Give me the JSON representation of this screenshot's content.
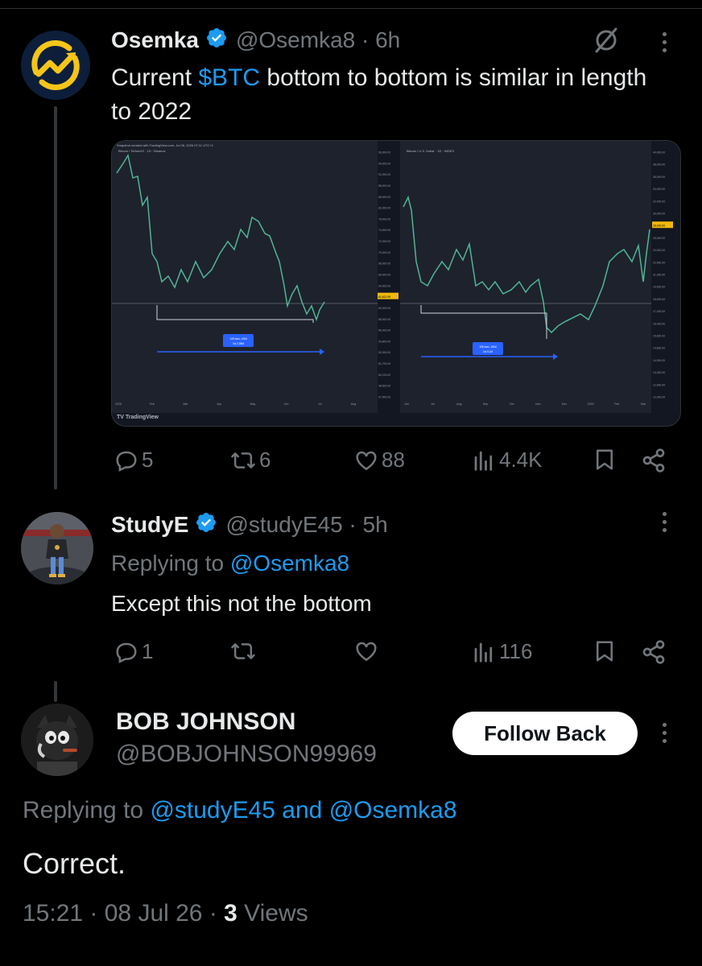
{
  "tweet1": {
    "name": "Osemka",
    "handle_meta": "@Osemka8 · 6h",
    "text_pre": "Current ",
    "cashtag": "$BTC",
    "text_post": " bottom to bottom is similar in length to 2022",
    "stats": {
      "replies": "5",
      "reposts": "6",
      "likes": "88",
      "views": "4.4K"
    },
    "icons": {
      "avatar": "osemka-logo",
      "grok": "slash-circle-icon"
    }
  },
  "chart_image": {
    "left_header": "Bitcoin / TetherUS · 1D · Binance",
    "right_header": "Bitcoin / U.S. Dollar · 1D · INDEX",
    "left_box": [
      "145 bars, 145d",
      "Vol 2.85M"
    ],
    "right_box": [
      "156 bars, 156d",
      "Vol 5.1M"
    ],
    "price_axis_left": [
      "96,000.00",
      "94,000.00",
      "92,000.00",
      "88,000.00",
      "86,000.00",
      "82,000.00",
      "78,000.00",
      "74,000.00",
      "72,000.00",
      "70,000.00",
      "68,000.00",
      "66,000.00",
      "64,000.00",
      "62,622.99",
      "60,000.00",
      "58,000.00",
      "56,400.00",
      "54,800.00",
      "53,300.00",
      "51,700.00",
      "50,100.00",
      "48,500.00",
      "47,500.00"
    ],
    "price_axis_right": [
      "40,000.00",
      "38,000.00",
      "36,000.00",
      "34,000.00",
      "32,000.00",
      "30,000.00",
      "28,000.00",
      "26,000.00",
      "24,000.00",
      "22,500.00",
      "21,000.00",
      "19,600.00",
      "18,600.00",
      "17,400.00",
      "16,400.00",
      "15,600.00",
      "14,800.00",
      "14,000.00",
      "13,300.00",
      "12,600.00",
      "12,000.00"
    ],
    "highlight_left": "62,622.99",
    "highlight_right": "28,000.00",
    "left_dates": [
      "2025",
      "Feb",
      "Mar",
      "Apr",
      "May",
      "Jun",
      "Jul",
      "Aug"
    ],
    "right_dates": [
      "Jun",
      "Jul",
      "Aug",
      "Sep",
      "Oct",
      "Nov",
      "Dec",
      "2023",
      "Feb",
      "Mar"
    ],
    "watermark": "TradingView",
    "caption": "Snapshot created with TradingView.com, Jul 08, 2026 07:11 UTC+2"
  },
  "tweet2": {
    "name": "StudyE",
    "handle_meta": "@studyE45 · 5h",
    "replying_label": "Replying to ",
    "replying_to": "@Osemka8",
    "text": "Except this not the bottom",
    "stats": {
      "replies": "1",
      "reposts": "",
      "likes": "",
      "views": "116"
    }
  },
  "tweet3": {
    "name": "BOB JOHNSON",
    "handle": "@BOBJOHNSON99969",
    "follow_label": "Follow Back",
    "replying_label": "Replying to ",
    "replying_to": "@studyE45 and @Osemka8",
    "text": "Correct.",
    "timestamp": "15:21 · 08 Jul 26 · ",
    "views_count": "3",
    "views_label": " Views"
  },
  "colors": {
    "background": "#000000",
    "text": "#e7e9ea",
    "muted": "#71767b",
    "link": "#1d9bf0",
    "verified": "#1d9bf0",
    "logo_yellow": "#f5c518",
    "logo_navy": "#0c1e3a"
  }
}
